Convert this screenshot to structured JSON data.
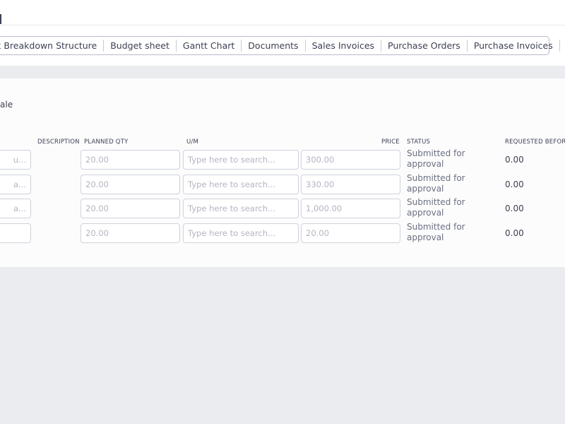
{
  "tabs": [
    "rk Breakdown Structure",
    "Budget sheet",
    "Gantt Chart",
    "Documents",
    "Sales Invoices",
    "Purchase Orders",
    "Purchase Invoices"
  ],
  "tabs_more_label": "···",
  "card": {
    "title": "ale",
    "columns": {
      "description": "DESCRIPTION",
      "planned_qty": "PLANNED QTY",
      "um": "U/M",
      "price": "PRICE",
      "status": "STATUS",
      "requested_before": "REQUESTED BEFORE"
    },
    "rows": [
      {
        "item": "u...",
        "planned_qty": "20.00",
        "um_placeholder": "Type here to search...",
        "price": "300.00",
        "status": "Submitted for approval",
        "requested_before": "0.00"
      },
      {
        "item": "a...",
        "planned_qty": "20.00",
        "um_placeholder": "Type here to search...",
        "price": "330.00",
        "status": "Submitted for approval",
        "requested_before": "0.00"
      },
      {
        "item": "a...",
        "planned_qty": "20.00",
        "um_placeholder": "Type here to search...",
        "price": "1,000.00",
        "status": "Submitted for approval",
        "requested_before": "0.00"
      },
      {
        "item": "",
        "planned_qty": "20.00",
        "um_placeholder": "Type here to search...",
        "price": "20.00",
        "status": "Submitted for approval",
        "requested_before": "0.00"
      }
    ]
  }
}
